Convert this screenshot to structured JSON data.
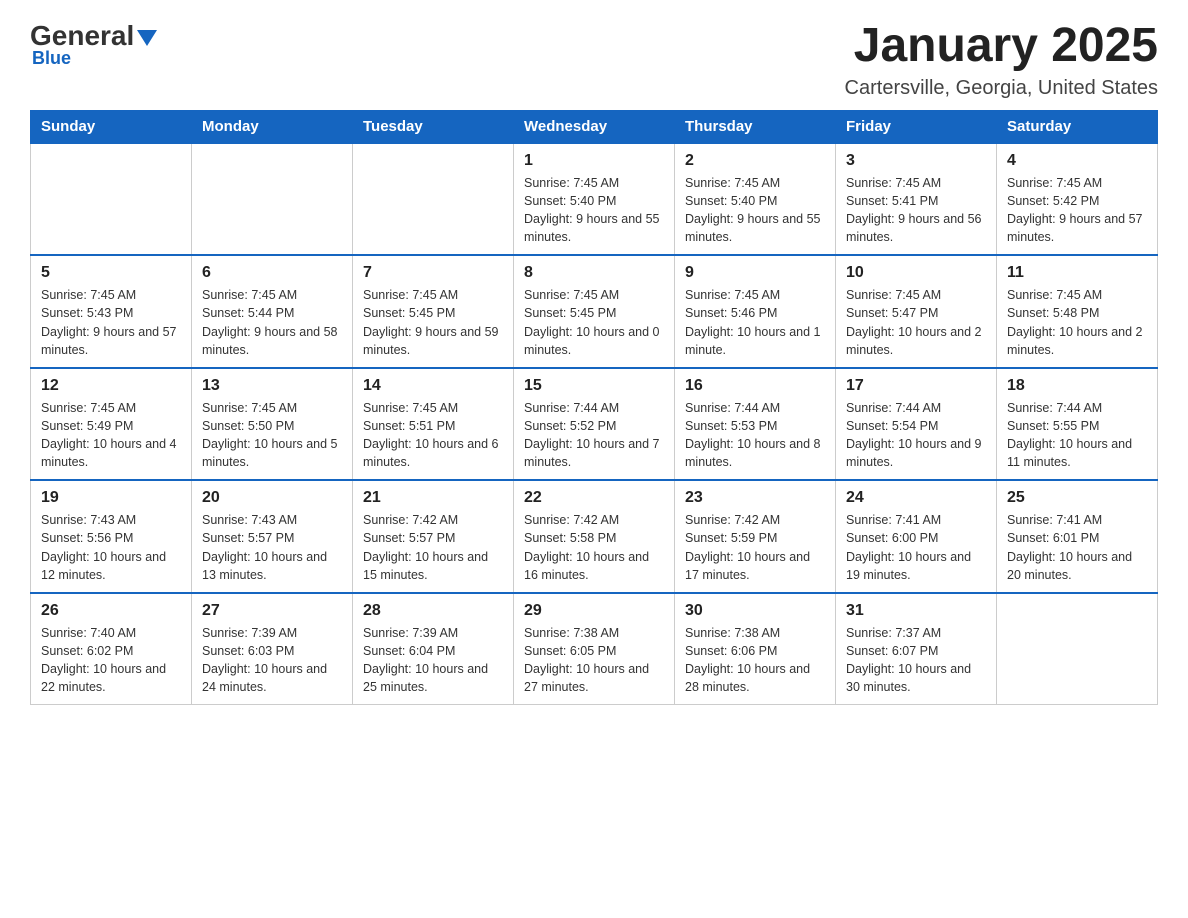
{
  "logo": {
    "name_general": "General",
    "name_blue": "Blue"
  },
  "title": "January 2025",
  "location": "Cartersville, Georgia, United States",
  "days_of_week": [
    "Sunday",
    "Monday",
    "Tuesday",
    "Wednesday",
    "Thursday",
    "Friday",
    "Saturday"
  ],
  "weeks": [
    [
      {
        "day": "",
        "sunrise": "",
        "sunset": "",
        "daylight": ""
      },
      {
        "day": "",
        "sunrise": "",
        "sunset": "",
        "daylight": ""
      },
      {
        "day": "",
        "sunrise": "",
        "sunset": "",
        "daylight": ""
      },
      {
        "day": "1",
        "sunrise": "Sunrise: 7:45 AM",
        "sunset": "Sunset: 5:40 PM",
        "daylight": "Daylight: 9 hours and 55 minutes."
      },
      {
        "day": "2",
        "sunrise": "Sunrise: 7:45 AM",
        "sunset": "Sunset: 5:40 PM",
        "daylight": "Daylight: 9 hours and 55 minutes."
      },
      {
        "day": "3",
        "sunrise": "Sunrise: 7:45 AM",
        "sunset": "Sunset: 5:41 PM",
        "daylight": "Daylight: 9 hours and 56 minutes."
      },
      {
        "day": "4",
        "sunrise": "Sunrise: 7:45 AM",
        "sunset": "Sunset: 5:42 PM",
        "daylight": "Daylight: 9 hours and 57 minutes."
      }
    ],
    [
      {
        "day": "5",
        "sunrise": "Sunrise: 7:45 AM",
        "sunset": "Sunset: 5:43 PM",
        "daylight": "Daylight: 9 hours and 57 minutes."
      },
      {
        "day": "6",
        "sunrise": "Sunrise: 7:45 AM",
        "sunset": "Sunset: 5:44 PM",
        "daylight": "Daylight: 9 hours and 58 minutes."
      },
      {
        "day": "7",
        "sunrise": "Sunrise: 7:45 AM",
        "sunset": "Sunset: 5:45 PM",
        "daylight": "Daylight: 9 hours and 59 minutes."
      },
      {
        "day": "8",
        "sunrise": "Sunrise: 7:45 AM",
        "sunset": "Sunset: 5:45 PM",
        "daylight": "Daylight: 10 hours and 0 minutes."
      },
      {
        "day": "9",
        "sunrise": "Sunrise: 7:45 AM",
        "sunset": "Sunset: 5:46 PM",
        "daylight": "Daylight: 10 hours and 1 minute."
      },
      {
        "day": "10",
        "sunrise": "Sunrise: 7:45 AM",
        "sunset": "Sunset: 5:47 PM",
        "daylight": "Daylight: 10 hours and 2 minutes."
      },
      {
        "day": "11",
        "sunrise": "Sunrise: 7:45 AM",
        "sunset": "Sunset: 5:48 PM",
        "daylight": "Daylight: 10 hours and 2 minutes."
      }
    ],
    [
      {
        "day": "12",
        "sunrise": "Sunrise: 7:45 AM",
        "sunset": "Sunset: 5:49 PM",
        "daylight": "Daylight: 10 hours and 4 minutes."
      },
      {
        "day": "13",
        "sunrise": "Sunrise: 7:45 AM",
        "sunset": "Sunset: 5:50 PM",
        "daylight": "Daylight: 10 hours and 5 minutes."
      },
      {
        "day": "14",
        "sunrise": "Sunrise: 7:45 AM",
        "sunset": "Sunset: 5:51 PM",
        "daylight": "Daylight: 10 hours and 6 minutes."
      },
      {
        "day": "15",
        "sunrise": "Sunrise: 7:44 AM",
        "sunset": "Sunset: 5:52 PM",
        "daylight": "Daylight: 10 hours and 7 minutes."
      },
      {
        "day": "16",
        "sunrise": "Sunrise: 7:44 AM",
        "sunset": "Sunset: 5:53 PM",
        "daylight": "Daylight: 10 hours and 8 minutes."
      },
      {
        "day": "17",
        "sunrise": "Sunrise: 7:44 AM",
        "sunset": "Sunset: 5:54 PM",
        "daylight": "Daylight: 10 hours and 9 minutes."
      },
      {
        "day": "18",
        "sunrise": "Sunrise: 7:44 AM",
        "sunset": "Sunset: 5:55 PM",
        "daylight": "Daylight: 10 hours and 11 minutes."
      }
    ],
    [
      {
        "day": "19",
        "sunrise": "Sunrise: 7:43 AM",
        "sunset": "Sunset: 5:56 PM",
        "daylight": "Daylight: 10 hours and 12 minutes."
      },
      {
        "day": "20",
        "sunrise": "Sunrise: 7:43 AM",
        "sunset": "Sunset: 5:57 PM",
        "daylight": "Daylight: 10 hours and 13 minutes."
      },
      {
        "day": "21",
        "sunrise": "Sunrise: 7:42 AM",
        "sunset": "Sunset: 5:57 PM",
        "daylight": "Daylight: 10 hours and 15 minutes."
      },
      {
        "day": "22",
        "sunrise": "Sunrise: 7:42 AM",
        "sunset": "Sunset: 5:58 PM",
        "daylight": "Daylight: 10 hours and 16 minutes."
      },
      {
        "day": "23",
        "sunrise": "Sunrise: 7:42 AM",
        "sunset": "Sunset: 5:59 PM",
        "daylight": "Daylight: 10 hours and 17 minutes."
      },
      {
        "day": "24",
        "sunrise": "Sunrise: 7:41 AM",
        "sunset": "Sunset: 6:00 PM",
        "daylight": "Daylight: 10 hours and 19 minutes."
      },
      {
        "day": "25",
        "sunrise": "Sunrise: 7:41 AM",
        "sunset": "Sunset: 6:01 PM",
        "daylight": "Daylight: 10 hours and 20 minutes."
      }
    ],
    [
      {
        "day": "26",
        "sunrise": "Sunrise: 7:40 AM",
        "sunset": "Sunset: 6:02 PM",
        "daylight": "Daylight: 10 hours and 22 minutes."
      },
      {
        "day": "27",
        "sunrise": "Sunrise: 7:39 AM",
        "sunset": "Sunset: 6:03 PM",
        "daylight": "Daylight: 10 hours and 24 minutes."
      },
      {
        "day": "28",
        "sunrise": "Sunrise: 7:39 AM",
        "sunset": "Sunset: 6:04 PM",
        "daylight": "Daylight: 10 hours and 25 minutes."
      },
      {
        "day": "29",
        "sunrise": "Sunrise: 7:38 AM",
        "sunset": "Sunset: 6:05 PM",
        "daylight": "Daylight: 10 hours and 27 minutes."
      },
      {
        "day": "30",
        "sunrise": "Sunrise: 7:38 AM",
        "sunset": "Sunset: 6:06 PM",
        "daylight": "Daylight: 10 hours and 28 minutes."
      },
      {
        "day": "31",
        "sunrise": "Sunrise: 7:37 AM",
        "sunset": "Sunset: 6:07 PM",
        "daylight": "Daylight: 10 hours and 30 minutes."
      },
      {
        "day": "",
        "sunrise": "",
        "sunset": "",
        "daylight": ""
      }
    ]
  ]
}
